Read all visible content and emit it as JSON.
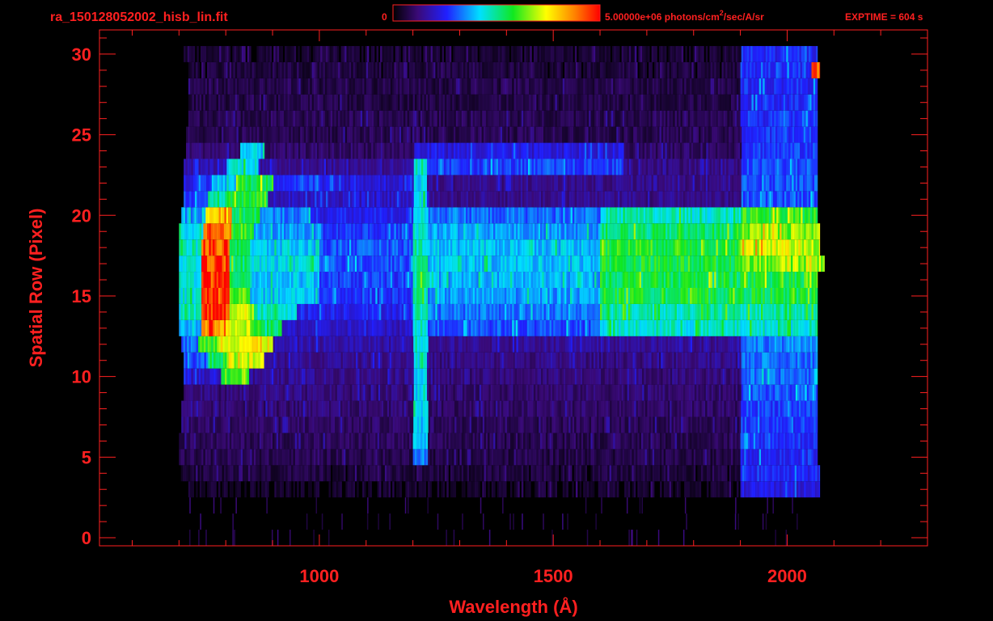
{
  "chart_data": {
    "type": "heatmap",
    "filename": "ra_150128052002_hisb_lin.fit",
    "colorbar": {
      "min_label": "0",
      "max_label": "5.00000e+06 photons/cm",
      "max_label_sup": "2",
      "max_label_tail": "/sec/A/sr",
      "colormap": "rainbow"
    },
    "exptime_label": "EXPTIME = 604 s",
    "xlabel": "Wavelength (Å)",
    "ylabel": "Spatial Row (Pixel)",
    "xlim": [
      530,
      2300
    ],
    "ylim": [
      -0.5,
      31.5
    ],
    "x_ticks": [
      1000,
      1500,
      2000
    ],
    "x_tick_labels": [
      "1000",
      "1500",
      "2000"
    ],
    "y_ticks": [
      0,
      5,
      10,
      15,
      20,
      25,
      30
    ],
    "y_tick_labels": [
      "0",
      "5",
      "10",
      "15",
      "20",
      "25",
      "30"
    ],
    "value_range": [
      0,
      5000000
    ],
    "rows": [
      {
        "row": 3,
        "start": 720,
        "end": 2070,
        "bands": [
          [
            720,
            1900,
            0.04
          ],
          [
            1900,
            2070,
            0.22
          ]
        ]
      },
      {
        "row": 4,
        "start": 700,
        "end": 2070,
        "bands": [
          [
            700,
            1900,
            0.06
          ],
          [
            1900,
            2070,
            0.25
          ]
        ]
      },
      {
        "row": 5,
        "start": 700,
        "end": 2065,
        "bands": [
          [
            700,
            1200,
            0.08
          ],
          [
            1200,
            1230,
            0.35
          ],
          [
            1230,
            1900,
            0.07
          ],
          [
            1900,
            2065,
            0.26
          ]
        ]
      },
      {
        "row": 6,
        "start": 700,
        "end": 2065,
        "bands": [
          [
            700,
            1200,
            0.09
          ],
          [
            1200,
            1230,
            0.38
          ],
          [
            1230,
            1900,
            0.08
          ],
          [
            1900,
            2065,
            0.27
          ]
        ]
      },
      {
        "row": 7,
        "start": 705,
        "end": 2065,
        "bands": [
          [
            705,
            1200,
            0.1
          ],
          [
            1200,
            1230,
            0.4
          ],
          [
            1230,
            1900,
            0.09
          ],
          [
            1900,
            2065,
            0.28
          ]
        ]
      },
      {
        "row": 8,
        "start": 705,
        "end": 2065,
        "bands": [
          [
            705,
            1200,
            0.11
          ],
          [
            1200,
            1230,
            0.42
          ],
          [
            1230,
            1900,
            0.1
          ],
          [
            1900,
            2065,
            0.29
          ]
        ]
      },
      {
        "row": 9,
        "start": 710,
        "end": 2065,
        "bands": [
          [
            710,
            1200,
            0.12
          ],
          [
            1200,
            1230,
            0.42
          ],
          [
            1230,
            1900,
            0.11
          ],
          [
            1900,
            2065,
            0.3
          ]
        ]
      },
      {
        "row": 10,
        "start": 710,
        "end": 2065,
        "bands": [
          [
            710,
            790,
            0.2
          ],
          [
            790,
            850,
            0.62
          ],
          [
            850,
            1200,
            0.14
          ],
          [
            1200,
            1230,
            0.44
          ],
          [
            1230,
            1900,
            0.12
          ],
          [
            1900,
            2065,
            0.32
          ]
        ]
      },
      {
        "row": 11,
        "start": 710,
        "end": 2065,
        "bands": [
          [
            710,
            760,
            0.3
          ],
          [
            760,
            800,
            0.55
          ],
          [
            800,
            880,
            0.7
          ],
          [
            880,
            1200,
            0.15
          ],
          [
            1200,
            1230,
            0.45
          ],
          [
            1230,
            1900,
            0.13
          ],
          [
            1900,
            2065,
            0.33
          ]
        ]
      },
      {
        "row": 12,
        "start": 705,
        "end": 2065,
        "bands": [
          [
            705,
            740,
            0.32
          ],
          [
            740,
            780,
            0.6
          ],
          [
            780,
            900,
            0.75
          ],
          [
            900,
            1200,
            0.17
          ],
          [
            1200,
            1230,
            0.46
          ],
          [
            1230,
            1900,
            0.15
          ],
          [
            1900,
            2065,
            0.34
          ]
        ]
      },
      {
        "row": 13,
        "start": 700,
        "end": 2065,
        "bands": [
          [
            700,
            745,
            0.4
          ],
          [
            745,
            800,
            0.85
          ],
          [
            800,
            860,
            0.68
          ],
          [
            860,
            920,
            0.5
          ],
          [
            920,
            1200,
            0.2
          ],
          [
            1200,
            1230,
            0.46
          ],
          [
            1230,
            1600,
            0.3
          ],
          [
            1600,
            2065,
            0.45
          ]
        ]
      },
      {
        "row": 14,
        "start": 700,
        "end": 2065,
        "bands": [
          [
            700,
            745,
            0.45
          ],
          [
            745,
            805,
            0.95
          ],
          [
            805,
            860,
            0.7
          ],
          [
            860,
            950,
            0.46
          ],
          [
            950,
            1200,
            0.25
          ],
          [
            1200,
            1230,
            0.48
          ],
          [
            1230,
            1600,
            0.33
          ],
          [
            1600,
            2065,
            0.48
          ]
        ]
      },
      {
        "row": 15,
        "start": 700,
        "end": 2065,
        "bands": [
          [
            700,
            745,
            0.45
          ],
          [
            745,
            805,
            0.95
          ],
          [
            805,
            850,
            0.62
          ],
          [
            850,
            1000,
            0.4
          ],
          [
            1000,
            1200,
            0.27
          ],
          [
            1200,
            1230,
            0.5
          ],
          [
            1230,
            1600,
            0.36
          ],
          [
            1600,
            2065,
            0.55
          ]
        ]
      },
      {
        "row": 16,
        "start": 700,
        "end": 2065,
        "bands": [
          [
            700,
            745,
            0.45
          ],
          [
            745,
            805,
            0.95
          ],
          [
            805,
            850,
            0.55
          ],
          [
            850,
            1000,
            0.4
          ],
          [
            1000,
            1200,
            0.28
          ],
          [
            1200,
            1230,
            0.5
          ],
          [
            1230,
            1600,
            0.38
          ],
          [
            1600,
            2065,
            0.55
          ]
        ]
      },
      {
        "row": 17,
        "start": 700,
        "end": 2080,
        "bands": [
          [
            700,
            745,
            0.45
          ],
          [
            745,
            805,
            0.95
          ],
          [
            805,
            850,
            0.52
          ],
          [
            850,
            1000,
            0.42
          ],
          [
            1000,
            1200,
            0.3
          ],
          [
            1200,
            1230,
            0.48
          ],
          [
            1230,
            1600,
            0.4
          ],
          [
            1600,
            1900,
            0.56
          ],
          [
            1900,
            2080,
            0.66
          ]
        ]
      },
      {
        "row": 18,
        "start": 700,
        "end": 2070,
        "bands": [
          [
            700,
            745,
            0.45
          ],
          [
            745,
            805,
            0.93
          ],
          [
            805,
            850,
            0.56
          ],
          [
            850,
            1000,
            0.4
          ],
          [
            1000,
            1200,
            0.3
          ],
          [
            1200,
            1230,
            0.48
          ],
          [
            1230,
            1600,
            0.4
          ],
          [
            1600,
            1900,
            0.58
          ],
          [
            1900,
            2070,
            0.7
          ]
        ]
      },
      {
        "row": 19,
        "start": 700,
        "end": 2070,
        "bands": [
          [
            700,
            750,
            0.42
          ],
          [
            750,
            810,
            0.9
          ],
          [
            810,
            860,
            0.6
          ],
          [
            860,
            1000,
            0.36
          ],
          [
            1000,
            1200,
            0.27
          ],
          [
            1200,
            1230,
            0.46
          ],
          [
            1230,
            1600,
            0.36
          ],
          [
            1600,
            1900,
            0.52
          ],
          [
            1900,
            2070,
            0.66
          ]
        ]
      },
      {
        "row": 20,
        "start": 705,
        "end": 2065,
        "bands": [
          [
            705,
            755,
            0.36
          ],
          [
            755,
            810,
            0.8
          ],
          [
            810,
            870,
            0.55
          ],
          [
            870,
            980,
            0.34
          ],
          [
            980,
            1200,
            0.24
          ],
          [
            1200,
            1230,
            0.45
          ],
          [
            1230,
            1600,
            0.32
          ],
          [
            1600,
            1900,
            0.46
          ],
          [
            1900,
            2065,
            0.58
          ]
        ]
      },
      {
        "row": 21,
        "start": 710,
        "end": 2065,
        "bands": [
          [
            710,
            760,
            0.28
          ],
          [
            760,
            800,
            0.5
          ],
          [
            800,
            890,
            0.58
          ],
          [
            890,
            1200,
            0.2
          ],
          [
            1200,
            1230,
            0.42
          ],
          [
            1230,
            1900,
            0.14
          ],
          [
            1900,
            2065,
            0.3
          ]
        ]
      },
      {
        "row": 22,
        "start": 710,
        "end": 2065,
        "bands": [
          [
            710,
            770,
            0.25
          ],
          [
            770,
            820,
            0.4
          ],
          [
            820,
            900,
            0.56
          ],
          [
            900,
            1000,
            0.28
          ],
          [
            1000,
            1200,
            0.22
          ],
          [
            1200,
            1230,
            0.42
          ],
          [
            1230,
            1900,
            0.14
          ],
          [
            1900,
            2065,
            0.3
          ]
        ]
      },
      {
        "row": 23,
        "start": 710,
        "end": 2065,
        "bands": [
          [
            710,
            800,
            0.18
          ],
          [
            800,
            870,
            0.45
          ],
          [
            870,
            1200,
            0.15
          ],
          [
            1200,
            1230,
            0.4
          ],
          [
            1230,
            1650,
            0.28
          ],
          [
            1650,
            1900,
            0.13
          ],
          [
            1900,
            2065,
            0.29
          ]
        ]
      },
      {
        "row": 24,
        "start": 715,
        "end": 2065,
        "bands": [
          [
            715,
            830,
            0.12
          ],
          [
            830,
            880,
            0.4
          ],
          [
            880,
            1200,
            0.1
          ],
          [
            1200,
            1650,
            0.22
          ],
          [
            1650,
            1900,
            0.1
          ],
          [
            1900,
            2065,
            0.28
          ]
        ]
      },
      {
        "row": 25,
        "start": 715,
        "end": 2065,
        "bands": [
          [
            715,
            1900,
            0.08
          ],
          [
            1900,
            2065,
            0.27
          ]
        ]
      },
      {
        "row": 26,
        "start": 720,
        "end": 2065,
        "bands": [
          [
            720,
            1900,
            0.08
          ],
          [
            1900,
            2065,
            0.27
          ]
        ]
      },
      {
        "row": 27,
        "start": 720,
        "end": 2065,
        "bands": [
          [
            720,
            1900,
            0.07
          ],
          [
            1900,
            2065,
            0.26
          ]
        ]
      },
      {
        "row": 28,
        "start": 720,
        "end": 2065,
        "bands": [
          [
            720,
            1900,
            0.07
          ],
          [
            1900,
            2065,
            0.26
          ]
        ]
      },
      {
        "row": 29,
        "start": 720,
        "end": 2070,
        "bands": [
          [
            720,
            1900,
            0.06
          ],
          [
            1900,
            2050,
            0.27
          ],
          [
            2050,
            2070,
            0.9
          ]
        ]
      },
      {
        "row": 30,
        "start": 710,
        "end": 2065,
        "bands": [
          [
            710,
            1900,
            0.05
          ],
          [
            1900,
            2065,
            0.26
          ]
        ]
      }
    ]
  },
  "colors": {
    "frame": "#ff2020",
    "text": "#ff2020",
    "background": "#000000"
  }
}
